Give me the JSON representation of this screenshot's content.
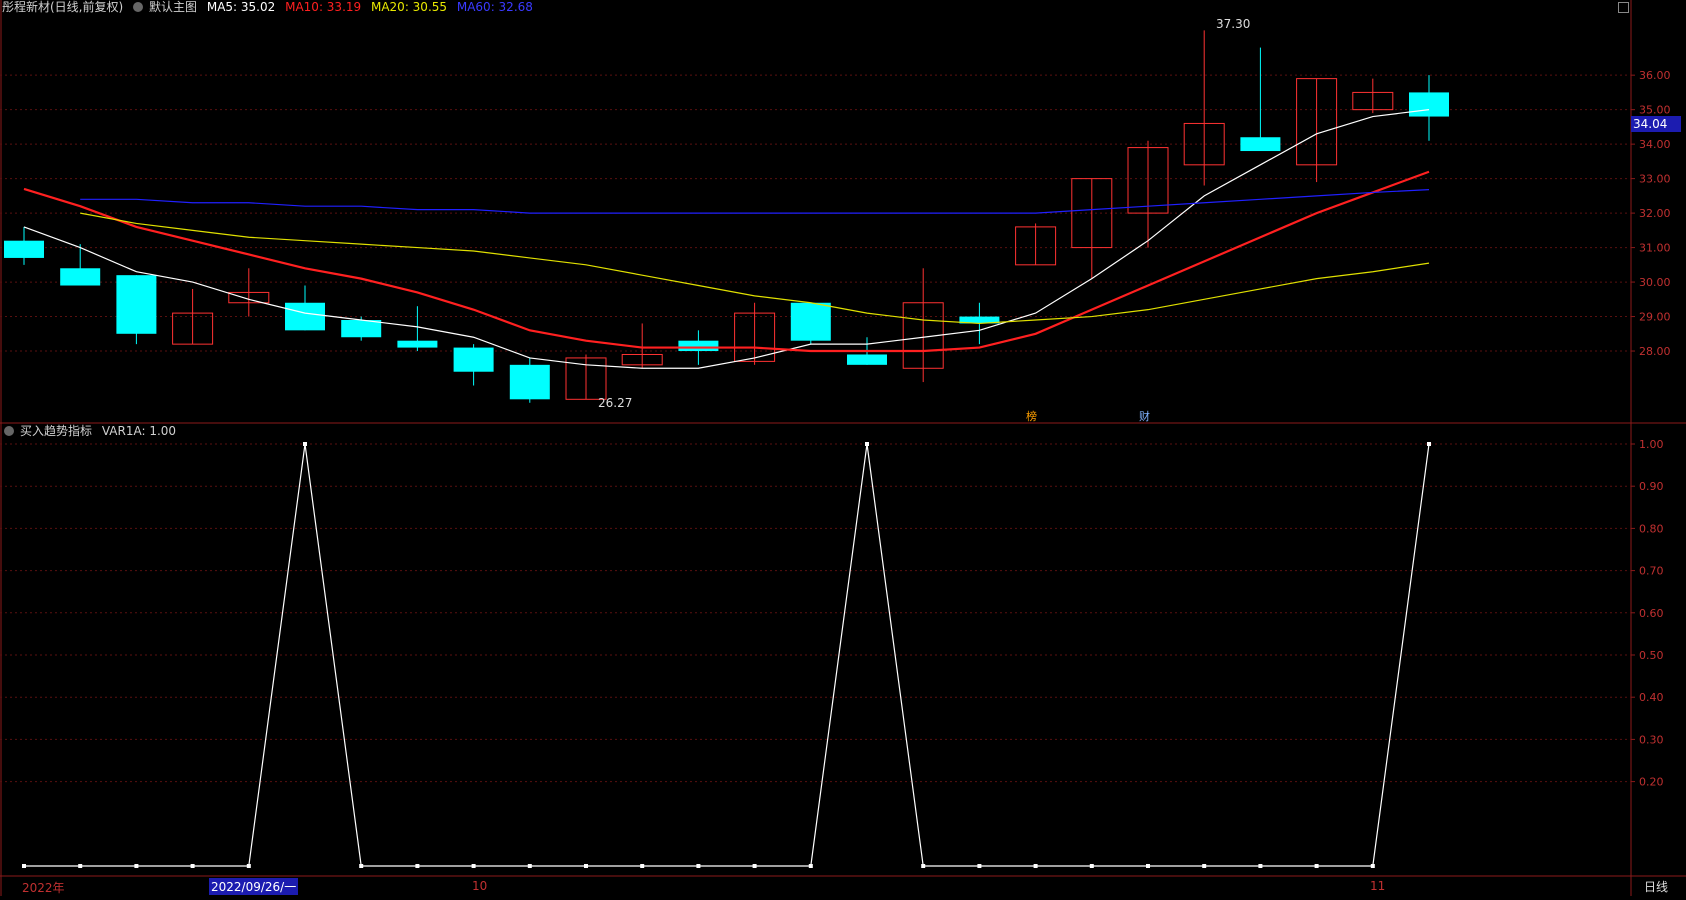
{
  "main_header": {
    "stock": "彤程新材(日线,前复权)",
    "indicator_name": "默认主图",
    "ma5": "MA5: 35.02",
    "ma10": "MA10: 33.19",
    "ma20": "MA20: 30.55",
    "ma60": "MA60: 32.68"
  },
  "sub_header": {
    "indicator_name": "买入趋势指标",
    "var": "VAR1A: 1.00"
  },
  "price_tag": "34.04",
  "high_label": "37.30",
  "low_label": "26.27",
  "markers": {
    "m1": "榜",
    "m2": "财"
  },
  "x_labels": {
    "year": "2022年",
    "selected": "2022/09/26/一",
    "oct": "10",
    "nov": "11"
  },
  "period": "日线",
  "colors": {
    "up": "#ff3232",
    "down": "#00ffff",
    "ma5": "#ffffff",
    "ma10": "#ff2020",
    "ma20": "#e0e000",
    "ma60": "#2020ff",
    "axis": "#8b1a1a"
  },
  "chart_data": [
    {
      "type": "candlestick",
      "title": "彤程新材(日线,前复权)",
      "y_ticks": [
        28.0,
        29.0,
        30.0,
        31.0,
        32.0,
        33.0,
        34.0,
        35.0,
        36.0
      ],
      "ylim": [
        26.0,
        37.6
      ],
      "candles": [
        {
          "o": 31.2,
          "h": 31.6,
          "l": 30.5,
          "c": 30.7
        },
        {
          "o": 30.4,
          "h": 31.1,
          "l": 29.9,
          "c": 29.9
        },
        {
          "o": 30.2,
          "h": 30.2,
          "l": 28.2,
          "c": 28.5
        },
        {
          "o": 28.2,
          "h": 29.8,
          "l": 28.2,
          "c": 29.1
        },
        {
          "o": 29.4,
          "h": 30.4,
          "l": 29.0,
          "c": 29.7
        },
        {
          "o": 29.4,
          "h": 29.9,
          "l": 28.6,
          "c": 28.6
        },
        {
          "o": 28.9,
          "h": 29.0,
          "l": 28.3,
          "c": 28.4
        },
        {
          "o": 28.3,
          "h": 29.3,
          "l": 28.0,
          "c": 28.1
        },
        {
          "o": 28.1,
          "h": 28.2,
          "l": 27.0,
          "c": 27.4
        },
        {
          "o": 27.6,
          "h": 27.8,
          "l": 26.5,
          "c": 26.6
        },
        {
          "o": 26.6,
          "h": 27.9,
          "l": 26.6,
          "c": 27.8
        },
        {
          "o": 27.6,
          "h": 28.8,
          "l": 27.5,
          "c": 27.9
        },
        {
          "o": 28.3,
          "h": 28.6,
          "l": 27.6,
          "c": 28.0
        },
        {
          "o": 27.7,
          "h": 29.4,
          "l": 27.6,
          "c": 29.1
        },
        {
          "o": 29.4,
          "h": 29.4,
          "l": 28.2,
          "c": 28.3
        },
        {
          "o": 27.9,
          "h": 28.4,
          "l": 27.6,
          "c": 27.6
        },
        {
          "o": 27.5,
          "h": 30.4,
          "l": 27.1,
          "c": 29.4
        },
        {
          "o": 29.0,
          "h": 29.4,
          "l": 28.2,
          "c": 28.8
        },
        {
          "o": 30.5,
          "h": 31.7,
          "l": 30.5,
          "c": 31.6
        },
        {
          "o": 31.0,
          "h": 33.0,
          "l": 30.1,
          "c": 33.0
        },
        {
          "o": 32.0,
          "h": 34.1,
          "l": 31.0,
          "c": 33.9
        },
        {
          "o": 33.4,
          "h": 37.3,
          "l": 32.8,
          "c": 34.6
        },
        {
          "o": 34.2,
          "h": 36.8,
          "l": 33.9,
          "c": 33.8
        },
        {
          "o": 33.4,
          "h": 35.9,
          "l": 32.9,
          "c": 35.9
        },
        {
          "o": 35.0,
          "h": 35.9,
          "l": 34.9,
          "c": 35.5
        },
        {
          "o": 35.5,
          "h": 36.0,
          "l": 34.1,
          "c": 34.8
        }
      ],
      "series": [
        {
          "name": "MA5",
          "values": [
            31.6,
            31.0,
            30.3,
            30.0,
            29.5,
            29.1,
            28.9,
            28.7,
            28.4,
            27.8,
            27.6,
            27.5,
            27.5,
            27.8,
            28.2,
            28.2,
            28.4,
            28.6,
            29.1,
            30.1,
            31.2,
            32.5,
            33.4,
            34.3,
            34.8,
            35.0
          ]
        },
        {
          "name": "MA10",
          "values": [
            32.7,
            32.2,
            31.6,
            31.2,
            30.8,
            30.4,
            30.1,
            29.7,
            29.2,
            28.6,
            28.3,
            28.1,
            28.1,
            28.1,
            28.0,
            28.0,
            28.0,
            28.1,
            28.5,
            29.2,
            29.9,
            30.6,
            31.3,
            32.0,
            32.6,
            33.2
          ]
        },
        {
          "name": "MA20",
          "values": [
            32.0,
            31.7,
            31.5,
            31.3,
            31.2,
            31.1,
            31.0,
            30.9,
            30.7,
            30.5,
            30.2,
            29.9,
            29.6,
            29.4,
            29.1,
            28.9,
            28.8,
            28.9,
            29.0,
            29.2,
            29.5,
            29.8,
            30.1,
            30.3,
            30.55
          ]
        },
        {
          "name": "MA60",
          "values": [
            32.4,
            32.4,
            32.3,
            32.3,
            32.2,
            32.2,
            32.1,
            32.1,
            32.0,
            32.0,
            32.0,
            32.0,
            32.0,
            32.0,
            32.0,
            32.0,
            32.0,
            32.0,
            32.1,
            32.2,
            32.3,
            32.4,
            32.5,
            32.6,
            32.68
          ]
        }
      ]
    },
    {
      "type": "line",
      "title": "买入趋势指标",
      "y_ticks": [
        0.2,
        0.3,
        0.4,
        0.5,
        0.6,
        0.7,
        0.8,
        0.9,
        1.0
      ],
      "ylim": [
        0,
        1
      ],
      "series": [
        {
          "name": "VAR1A",
          "values": [
            0,
            0,
            0,
            0,
            0,
            1,
            0,
            0,
            0,
            0,
            0,
            0,
            0,
            0,
            0,
            1,
            0,
            0,
            0,
            0,
            0,
            0,
            0,
            0,
            0,
            1
          ]
        }
      ]
    }
  ]
}
